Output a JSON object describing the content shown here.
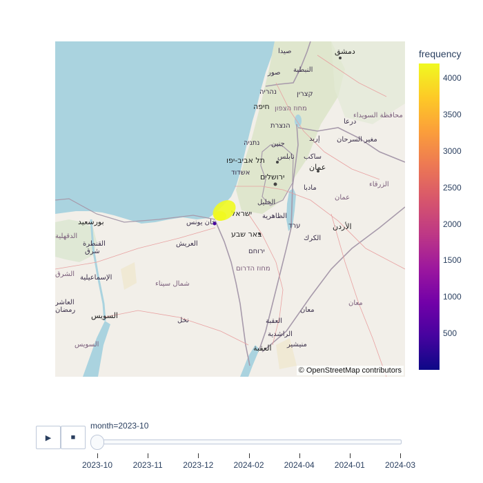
{
  "map": {
    "attribution": "© OpenStreetMap contributors",
    "points_color": "#f0f921",
    "place_labels": [
      {
        "id": "damascus",
        "text": "دمشق",
        "kind": "city"
      },
      {
        "id": "saida",
        "text": "صيدا",
        "kind": "place"
      },
      {
        "id": "nabatieh",
        "text": "النبطية",
        "kind": "place"
      },
      {
        "id": "sour",
        "text": "صور",
        "kind": "place"
      },
      {
        "id": "nahariya",
        "text": "נהריה",
        "kind": "place"
      },
      {
        "id": "qatzrin",
        "text": "קצרין",
        "kind": "place"
      },
      {
        "id": "haifa",
        "text": "חיפה",
        "kind": "city"
      },
      {
        "id": "north-district",
        "text": "מחוז הצפון",
        "kind": "region"
      },
      {
        "id": "as-suwayda",
        "text": "محافظة السويداء",
        "kind": "region"
      },
      {
        "id": "daraa",
        "text": "درعا",
        "kind": "place"
      },
      {
        "id": "nazareth",
        "text": "הנצרת",
        "kind": "place"
      },
      {
        "id": "irbid",
        "text": "إربد",
        "kind": "place"
      },
      {
        "id": "mughayyir",
        "text": "مغير السرحان",
        "kind": "place"
      },
      {
        "id": "netanya",
        "text": "נתניה",
        "kind": "place"
      },
      {
        "id": "jenin",
        "text": "جنين",
        "kind": "place"
      },
      {
        "id": "nablus",
        "text": "نابلس",
        "kind": "place"
      },
      {
        "id": "salt",
        "text": "ساكب",
        "kind": "place"
      },
      {
        "id": "tel-aviv",
        "text": "תל אביב-יפו",
        "kind": "city"
      },
      {
        "id": "amman",
        "text": "عمان",
        "kind": "city"
      },
      {
        "id": "ashdod",
        "text": "אשדוד",
        "kind": "place"
      },
      {
        "id": "jerusalem",
        "text": "ירושלים",
        "kind": "city"
      },
      {
        "id": "zarqa",
        "text": "الزرقاء",
        "kind": "place"
      },
      {
        "id": "madaba",
        "text": "مادبا",
        "kind": "place"
      },
      {
        "id": "amman-gov",
        "text": "عمان",
        "kind": "region"
      },
      {
        "id": "al-khalil",
        "text": "الخليل",
        "kind": "place"
      },
      {
        "id": "israel",
        "text": "ישראל",
        "kind": "city"
      },
      {
        "id": "port-said",
        "text": "بورسعيد",
        "kind": "place"
      },
      {
        "id": "khan-yunis",
        "text": "خان يونس",
        "kind": "place"
      },
      {
        "id": "dhahiriya",
        "text": "الظاهرية",
        "kind": "place"
      },
      {
        "id": "arad",
        "text": "ערד",
        "kind": "place"
      },
      {
        "id": "jordan",
        "text": "الأردن",
        "kind": "city"
      },
      {
        "id": "beer-sheva",
        "text": "באר שבע",
        "kind": "city"
      },
      {
        "id": "daqahlia",
        "text": "الدقهلية",
        "kind": "region"
      },
      {
        "id": "qantara",
        "text": "القنطرة",
        "kind": "place"
      },
      {
        "id": "sharq",
        "text": "شرق",
        "kind": "place"
      },
      {
        "id": "arish",
        "text": "العريش",
        "kind": "place"
      },
      {
        "id": "karak",
        "text": "الكرك",
        "kind": "place"
      },
      {
        "id": "yeruham",
        "text": "ירוחם",
        "kind": "place"
      },
      {
        "id": "sharqia",
        "text": "الشرق",
        "kind": "region"
      },
      {
        "id": "south-district",
        "text": "מחוז הדרום",
        "kind": "region"
      },
      {
        "id": "ismailia",
        "text": "الإسماعيلية",
        "kind": "place"
      },
      {
        "id": "north-sinai",
        "text": "شمال سيناء",
        "kind": "region"
      },
      {
        "id": "maan-gov",
        "text": "معان",
        "kind": "region"
      },
      {
        "id": "asher",
        "text": "العاشر",
        "kind": "place"
      },
      {
        "id": "ramadan",
        "text": "رمضان",
        "kind": "place"
      },
      {
        "id": "maan",
        "text": "معان",
        "kind": "place"
      },
      {
        "id": "suez",
        "text": "السويس",
        "kind": "city"
      },
      {
        "id": "nakhl",
        "text": "نخل",
        "kind": "place"
      },
      {
        "id": "aqaba-gov",
        "text": "العقبة",
        "kind": "place"
      },
      {
        "id": "rashidiya",
        "text": "الراشدية",
        "kind": "place"
      },
      {
        "id": "suez-gov",
        "text": "السويس",
        "kind": "region"
      },
      {
        "id": "aqaba",
        "text": "العقبة",
        "kind": "city"
      },
      {
        "id": "muneishir",
        "text": "منيشير",
        "kind": "place"
      }
    ]
  },
  "colorbar": {
    "title": "frequency",
    "min": 0,
    "max": 4200,
    "ticks": [
      "500",
      "1000",
      "1500",
      "2000",
      "2500",
      "3000",
      "3500",
      "4000"
    ]
  },
  "animation": {
    "play_icon": "▶",
    "stop_icon": "■",
    "current_label": "month=2023-10",
    "current_index": 0,
    "frames": [
      "2023-10",
      "2023-11",
      "2023-12",
      "2024-02",
      "2024-04",
      "2024-01",
      "2024-03"
    ]
  }
}
